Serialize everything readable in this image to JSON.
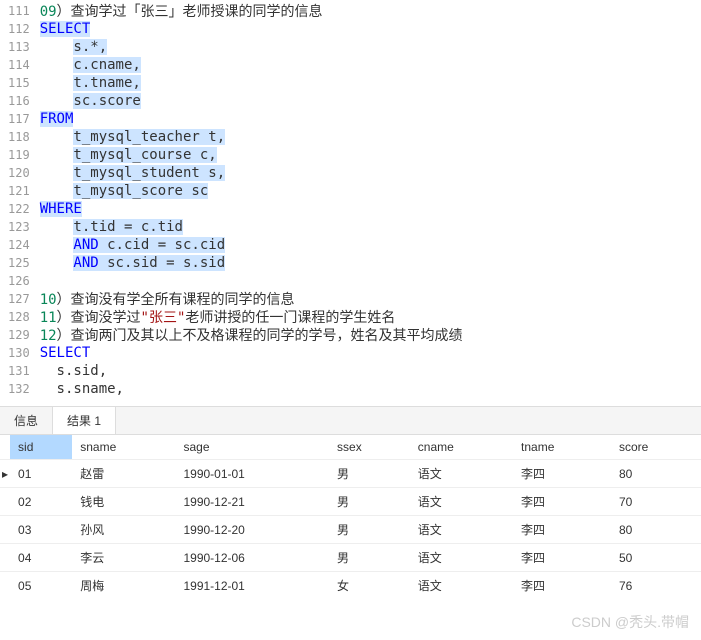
{
  "editor": {
    "lines": [
      {
        "n": 111,
        "segs": [
          {
            "cls": "num",
            "t": "09"
          },
          {
            "cls": "plain",
            "t": "）"
          },
          {
            "cls": "txt-cn",
            "t": "查询学过「张三」老师授课的同学的信息"
          }
        ]
      },
      {
        "n": 112,
        "segs": [
          {
            "cls": "kw hl",
            "t": "SELECT"
          }
        ]
      },
      {
        "n": 113,
        "segs": [
          {
            "cls": "plain",
            "t": "    "
          },
          {
            "cls": "plain hl",
            "t": "s.*,"
          }
        ]
      },
      {
        "n": 114,
        "segs": [
          {
            "cls": "plain",
            "t": "    "
          },
          {
            "cls": "plain hl",
            "t": "c.cname,"
          }
        ]
      },
      {
        "n": 115,
        "segs": [
          {
            "cls": "plain",
            "t": "    "
          },
          {
            "cls": "plain hl",
            "t": "t.tname,"
          }
        ]
      },
      {
        "n": 116,
        "segs": [
          {
            "cls": "plain",
            "t": "    "
          },
          {
            "cls": "plain hl",
            "t": "sc.score"
          }
        ]
      },
      {
        "n": 117,
        "segs": [
          {
            "cls": "kw hl",
            "t": "FROM"
          }
        ]
      },
      {
        "n": 118,
        "segs": [
          {
            "cls": "plain",
            "t": "    "
          },
          {
            "cls": "plain hl",
            "t": "t_mysql_teacher t,"
          }
        ]
      },
      {
        "n": 119,
        "segs": [
          {
            "cls": "plain",
            "t": "    "
          },
          {
            "cls": "plain hl",
            "t": "t_mysql_course c,"
          }
        ]
      },
      {
        "n": 120,
        "segs": [
          {
            "cls": "plain",
            "t": "    "
          },
          {
            "cls": "plain hl",
            "t": "t_mysql_student s,"
          }
        ]
      },
      {
        "n": 121,
        "segs": [
          {
            "cls": "plain",
            "t": "    "
          },
          {
            "cls": "plain hl",
            "t": "t_mysql_score sc"
          }
        ]
      },
      {
        "n": 122,
        "segs": [
          {
            "cls": "kw hl",
            "t": "WHERE"
          }
        ]
      },
      {
        "n": 123,
        "segs": [
          {
            "cls": "plain",
            "t": "    "
          },
          {
            "cls": "plain hl",
            "t": "t.tid = c.tid"
          }
        ]
      },
      {
        "n": 124,
        "segs": [
          {
            "cls": "plain",
            "t": "    "
          },
          {
            "cls": "kw hl",
            "t": "AND"
          },
          {
            "cls": "plain hl",
            "t": " c.cid = sc.cid"
          }
        ]
      },
      {
        "n": 125,
        "segs": [
          {
            "cls": "plain",
            "t": "    "
          },
          {
            "cls": "kw hl",
            "t": "AND"
          },
          {
            "cls": "plain hl",
            "t": " sc.sid = s.sid"
          }
        ]
      },
      {
        "n": 126,
        "segs": []
      },
      {
        "n": 127,
        "segs": [
          {
            "cls": "num",
            "t": "10"
          },
          {
            "cls": "plain",
            "t": "）"
          },
          {
            "cls": "txt-cn",
            "t": "查询没有学全所有课程的同学的信息"
          }
        ]
      },
      {
        "n": 128,
        "segs": [
          {
            "cls": "num",
            "t": "11"
          },
          {
            "cls": "plain",
            "t": "）"
          },
          {
            "cls": "txt-cn",
            "t": "查询没学过"
          },
          {
            "cls": "str",
            "t": "\"张三\""
          },
          {
            "cls": "txt-cn",
            "t": "老师讲授的任一门课程的学生姓名"
          }
        ]
      },
      {
        "n": 129,
        "segs": [
          {
            "cls": "num",
            "t": "12"
          },
          {
            "cls": "plain",
            "t": "）"
          },
          {
            "cls": "txt-cn",
            "t": "查询两门及其以上不及格课程的同学的学号，姓名及其平均成绩"
          }
        ]
      },
      {
        "n": 130,
        "segs": [
          {
            "cls": "kw",
            "t": "SELECT"
          }
        ]
      },
      {
        "n": 131,
        "segs": [
          {
            "cls": "plain",
            "t": "  s.sid,"
          }
        ]
      },
      {
        "n": 132,
        "segs": [
          {
            "cls": "plain",
            "t": "  s.sname,"
          }
        ]
      }
    ]
  },
  "tabs": {
    "items": [
      {
        "label": "信息",
        "active": false
      },
      {
        "label": "结果 1",
        "active": true
      }
    ]
  },
  "results": {
    "columns": [
      "sid",
      "sname",
      "sage",
      "ssex",
      "cname",
      "tname",
      "score"
    ],
    "selected_col": 0,
    "current_row": 0,
    "rows": [
      [
        "01",
        "赵雷",
        "1990-01-01",
        "男",
        "语文",
        "李四",
        "80"
      ],
      [
        "02",
        "钱电",
        "1990-12-21",
        "男",
        "语文",
        "李四",
        "70"
      ],
      [
        "03",
        "孙风",
        "1990-12-20",
        "男",
        "语文",
        "李四",
        "80"
      ],
      [
        "04",
        "李云",
        "1990-12-06",
        "男",
        "语文",
        "李四",
        "50"
      ],
      [
        "05",
        "周梅",
        "1991-12-01",
        "女",
        "语文",
        "李四",
        "76"
      ]
    ]
  },
  "watermark": "CSDN @秃头.带帽"
}
